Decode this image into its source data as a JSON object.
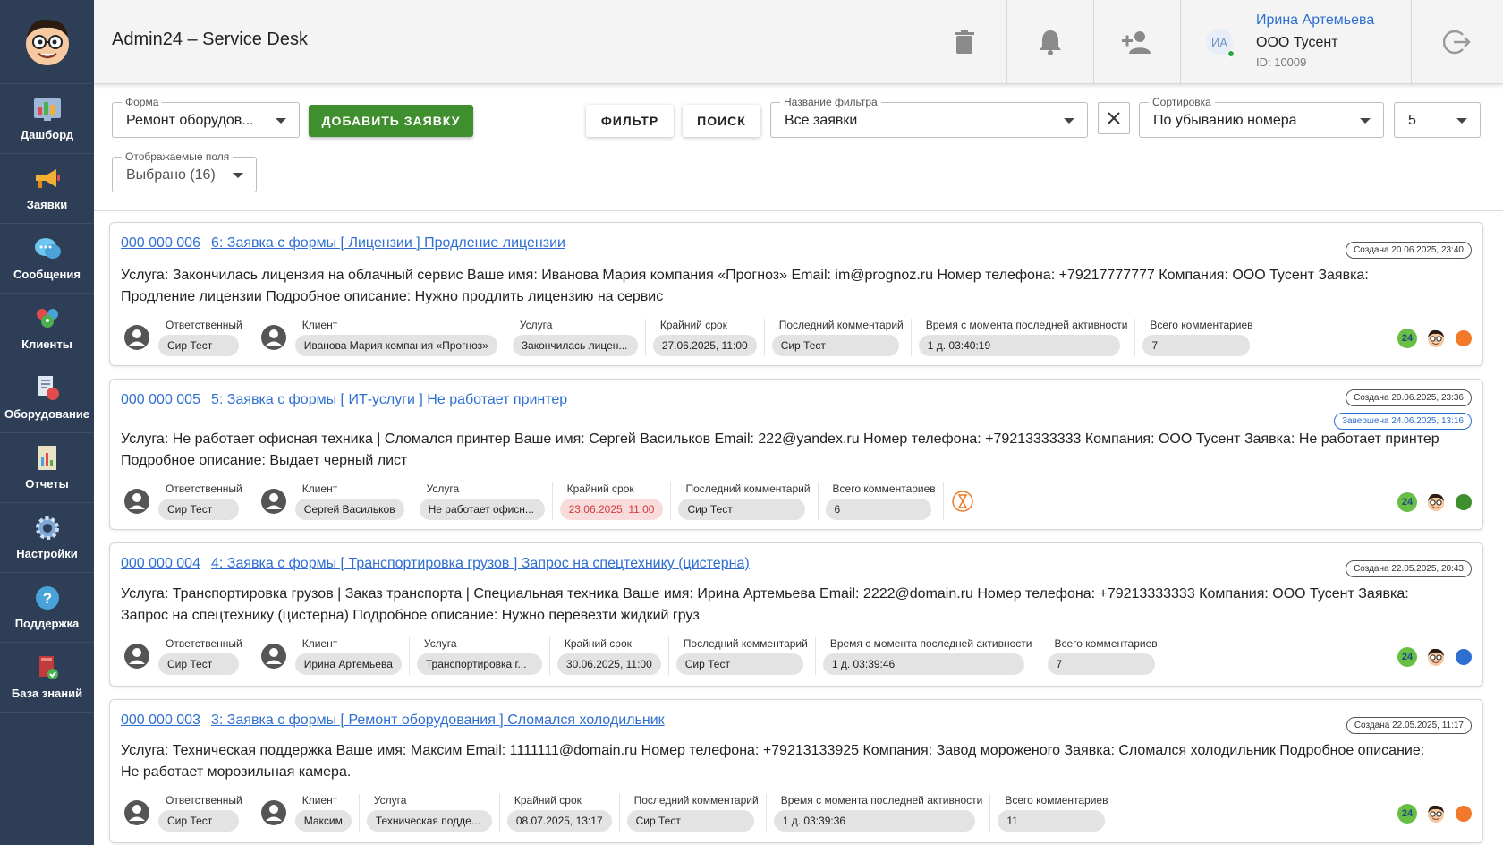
{
  "app": {
    "title": "Admin24 – Service Desk"
  },
  "sidebar": {
    "items": [
      {
        "label": "Дашборд",
        "icon": "dashboard-icon"
      },
      {
        "label": "Заявки",
        "icon": "megaphone-icon"
      },
      {
        "label": "Сообщения",
        "icon": "chat-bubbles-icon"
      },
      {
        "label": "Клиенты",
        "icon": "clients-icon"
      },
      {
        "label": "Оборудование",
        "icon": "equipment-icon"
      },
      {
        "label": "Отчеты",
        "icon": "reports-icon"
      },
      {
        "label": "Настройки",
        "icon": "gear-icon"
      },
      {
        "label": "Поддержка",
        "icon": "help-icon"
      },
      {
        "label": "База знаний",
        "icon": "knowledge-base-icon"
      }
    ]
  },
  "user": {
    "initials": "ИА",
    "name": "Ирина Артемьева",
    "company": "ООО Тусент",
    "id": "ID: 10009"
  },
  "toolbar": {
    "form": {
      "label": "Форма",
      "value": "Ремонт оборудов..."
    },
    "add_label": "ДОБАВИТЬ ЗАЯВКУ",
    "filter_label": "ФИЛЬТР",
    "search_label": "ПОИСК",
    "filter_name": {
      "label": "Название фильтра",
      "value": "Все заявки"
    },
    "sort": {
      "label": "Сортировка",
      "value": "По убыванию номера"
    },
    "page_size": {
      "value": "5"
    },
    "fields": {
      "label": "Отображаемые поля",
      "value": "Выбрано (16)"
    }
  },
  "colors": {
    "accent": "#2f6fd1",
    "green_button": "#3f8f2f",
    "sidebar": "#2e3e56"
  },
  "tickets": [
    {
      "number": "000 000 006",
      "title": "6: Заявка с формы [ Лицензии ] Продление лицензии",
      "created": "Создана 20.06.2025, 23:40",
      "body": "Услуга: Закончилась лицензия на облачный сервис Ваше имя: Иванова Мария компания «Прогноз» Email: im@prognoz.ru Номер телефона: +79217777777 Компания: ООО Тусент Заявка: Продление лицензии Подробное описание: Нужно продлить лицензию на сервис",
      "responsible_label": "Ответственный",
      "responsible": "Сир Тест",
      "client_label": "Клиент",
      "client": "Иванова Мария компания «Прогноз»",
      "service_label": "Услуга",
      "service": "Закончилась лицен...",
      "deadline_label": "Крайний срок",
      "deadline": "27.06.2025, 11:00",
      "last_comment_label": "Последний комментарий",
      "last_comment": "Сир Тест",
      "activity_label": "Время с момента последней активности",
      "activity": "1 д. 03:40:19",
      "comments_label": "Всего комментариев",
      "comments": "7",
      "status_color": "#f07a2a"
    },
    {
      "number": "000 000 005",
      "title": "5: Заявка с формы [ ИТ-услуги ] Не работает принтер",
      "created": "Создана 20.06.2025, 23:36",
      "completed": "Завершена 24.06.2025, 13:16",
      "body": "Услуга: Не работает офисная техника | Сломался принтер Ваше имя: Сергей Васильков Email: 222@yandex.ru Номер телефона: +79213333333 Компания: ООО Тусент Заявка: Не работает принтер Подробное описание: Выдает черный лист",
      "responsible_label": "Ответственный",
      "responsible": "Сир Тест",
      "client_label": "Клиент",
      "client": "Сергей Васильков",
      "service_label": "Услуга",
      "service": "Не работает офисн...",
      "deadline_label": "Крайний срок",
      "deadline": "23.06.2025, 11:00",
      "last_comment_label": "Последний комментарий",
      "last_comment": "Сир Тест",
      "comments_label": "Всего комментариев",
      "comments": "6",
      "status_color": "#3f8f2f"
    },
    {
      "number": "000 000 004",
      "title": "4: Заявка с формы [ Транспортировка грузов ] Запрос на спецтехнику (цистерна)",
      "created": "Создана 22.05.2025, 20:43",
      "body": "Услуга: Транспортировка грузов | Заказ транспорта | Специальная техника Ваше имя: Ирина Артемьева Email: 2222@domain.ru Номер телефона: +79213333333 Компания: ООО Тусент Заявка: Запрос на спецтехнику (цистерна) Подробное описание: Нужно перевезти жидкий груз",
      "responsible_label": "Ответственный",
      "responsible": "Сир Тест",
      "client_label": "Клиент",
      "client": "Ирина Артемьева",
      "service_label": "Услуга",
      "service": "Транспортировка г...",
      "deadline_label": "Крайний срок",
      "deadline": "30.06.2025, 11:00",
      "last_comment_label": "Последний комментарий",
      "last_comment": "Сир Тест",
      "activity_label": "Время с момента последней активности",
      "activity": "1 д. 03:39:46",
      "comments_label": "Всего комментариев",
      "comments": "7",
      "status_color": "#2f6fd1"
    },
    {
      "number": "000 000 003",
      "title": "3: Заявка с формы [ Ремонт оборудования ] Сломался холодильник",
      "created": "Создана 22.05.2025, 11:17",
      "body": "Услуга: Техническая поддержка Ваше имя: Максим Email: 1111111@domain.ru Номер телефона: +79213133925 Компания: Завод мороженого Заявка: Сломался холодильник Подробное описание: Не работает морозильная камера.",
      "responsible_label": "Ответственный",
      "responsible": "Сир Тест",
      "client_label": "Клиент",
      "client": "Максим",
      "service_label": "Услуга",
      "service": "Техническая подде...",
      "deadline_label": "Крайний срок",
      "deadline": "08.07.2025, 13:17",
      "last_comment_label": "Последний комментарий",
      "last_comment": "Сир Тест",
      "activity_label": "Время с момента последней активности",
      "activity": "1 д. 03:39:36",
      "comments_label": "Всего комментариев",
      "comments": "11",
      "status_color": "#f07a2a"
    }
  ],
  "badge_24": "24"
}
